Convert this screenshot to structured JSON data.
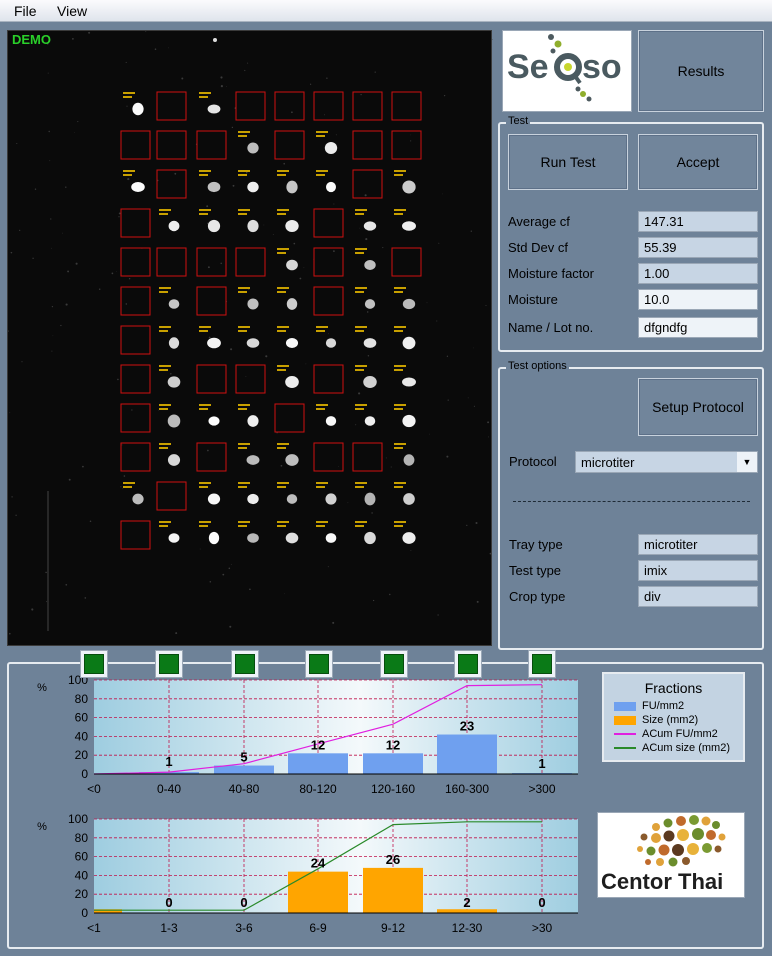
{
  "menu": {
    "file": "File",
    "view": "View"
  },
  "camera": {
    "demo_label": "DEMO"
  },
  "logos": {
    "top_brand": "SeQso",
    "bottom_brand": "Centor Thai"
  },
  "buttons": {
    "results": "Results",
    "run_test": "Run Test",
    "accept": "Accept",
    "setup_protocol": "Setup Protocol"
  },
  "test_group": {
    "title": "Test",
    "fields": [
      {
        "label": "Average cf",
        "value": "147.31"
      },
      {
        "label": "Std Dev cf",
        "value": "55.39"
      },
      {
        "label": "Moisture factor",
        "value": "1.00"
      },
      {
        "label": "Moisture",
        "value": "10.0"
      },
      {
        "label": "Name / Lot no.",
        "value": "dfgndfg"
      }
    ]
  },
  "test_options": {
    "title": "Test options",
    "protocol_label": "Protocol",
    "protocol_value": "microtiter",
    "fields": [
      {
        "label": "Tray type",
        "value": "microtiter"
      },
      {
        "label": "Test type",
        "value": "imix"
      },
      {
        "label": "Crop type",
        "value": "div"
      }
    ]
  },
  "legend": {
    "title": "Fractions",
    "items": [
      {
        "label": "FU/mm2",
        "color": "#6fa0ef",
        "kind": "bar"
      },
      {
        "label": "Size  (mm2)",
        "color": "#ffa500",
        "kind": "bar"
      },
      {
        "label": "ACum FU/mm2",
        "color": "#e020e0",
        "kind": "line"
      },
      {
        "label": "ACum size (mm2)",
        "color": "#2a8a2a",
        "kind": "line"
      }
    ]
  },
  "chart_data": [
    {
      "type": "bar",
      "ylabel": "%",
      "ylim": [
        0,
        100
      ],
      "yticks": [
        0,
        20,
        40,
        60,
        80,
        100
      ],
      "categories": [
        "<0",
        "0-40",
        "40-80",
        "80-120",
        "120-160",
        "160-300",
        ">300"
      ],
      "series": [
        {
          "name": "FU/mm2",
          "kind": "bar",
          "color": "#6fa0ef",
          "values": [
            0,
            2,
            9,
            22,
            22,
            42,
            1
          ],
          "labels": [
            "",
            "1",
            "5",
            "12",
            "12",
            "23",
            "1"
          ]
        },
        {
          "name": "ACum FU/mm2",
          "kind": "line",
          "color": "#e020e0",
          "values": [
            0,
            2,
            11,
            32,
            53,
            94,
            95
          ]
        }
      ]
    },
    {
      "type": "bar",
      "ylabel": "%",
      "ylim": [
        0,
        100
      ],
      "yticks": [
        0,
        20,
        40,
        60,
        80,
        100
      ],
      "categories": [
        "<1",
        "1-3",
        "3-6",
        "6-9",
        "9-12",
        "12-30",
        ">30"
      ],
      "series": [
        {
          "name": "Size  (mm2)",
          "kind": "bar",
          "color": "#ffa500",
          "values": [
            4,
            0,
            0,
            44,
            48,
            4,
            0
          ],
          "labels": [
            "",
            "0",
            "0",
            "24",
            "26",
            "2",
            "0"
          ]
        },
        {
          "name": "ACum size (mm2)",
          "kind": "line",
          "color": "#2a8a2a",
          "values": [
            3,
            3,
            3,
            47,
            94,
            97,
            97
          ]
        }
      ]
    }
  ]
}
